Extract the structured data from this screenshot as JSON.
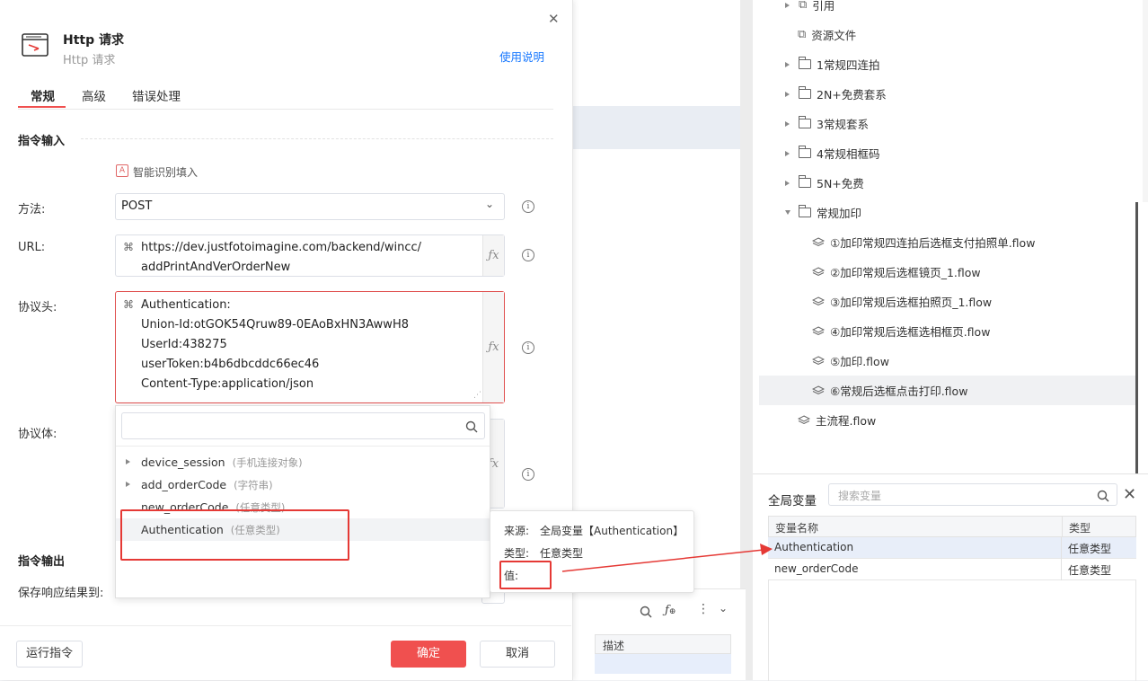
{
  "dialog": {
    "title": "Http 请求",
    "subtitle": "Http 请求",
    "help_link": "使用说明",
    "tabs": [
      "常规",
      "高级",
      "错误处理"
    ],
    "section_input": "指令输入",
    "smart_fill": "智能识别填入",
    "method_label": "方法:",
    "method_value": "POST",
    "url_label": "URL:",
    "url_line1": "https://dev.justfotoimagine.com/backend/wincc/",
    "url_line2": "addPrintAndVerOrderNew",
    "headers_label": "协议头:",
    "headers_lines": [
      "Authentication:",
      "Union-Id:otGOK54Qruw89-0EAoBxHN3AwwH8",
      "UserId:438275",
      "userToken:b4b6dbcddc66ec46",
      "Content-Type:application/json"
    ],
    "body_label": "协议体:",
    "section_output": "指令输出",
    "save_label": "保存响应结果到:",
    "run_button": "运行指令",
    "ok_button": "确定",
    "cancel_button": "取消",
    "fx_label": "ƒx",
    "info_label": "i"
  },
  "var_dropdown": {
    "items": [
      {
        "name": "device_session",
        "type": "(手机连接对象)"
      },
      {
        "name": "add_orderCode",
        "type": "(字符串)"
      },
      {
        "name": "new_orderCode",
        "type": "(任意类型)"
      },
      {
        "name": "Authentication",
        "type": "(任意类型)"
      }
    ]
  },
  "tooltip": {
    "source_label": "来源:",
    "source_value": "全局变量【Authentication】",
    "type_label": "类型:",
    "type_value": "任意类型",
    "value_label": "值:"
  },
  "tree": {
    "items": [
      {
        "label": "引用"
      },
      {
        "label": "资源文件"
      },
      {
        "label": "1常规四连拍"
      },
      {
        "label": "2N+免费套系"
      },
      {
        "label": "3常规套系"
      },
      {
        "label": "4常规相框码"
      },
      {
        "label": "5N+免费"
      },
      {
        "label": "常规加印"
      },
      {
        "label": "①加印常规四连拍后选框支付拍照单.flow"
      },
      {
        "label": "②加印常规后选框镜页_1.flow"
      },
      {
        "label": "③加印常规后选框拍照页_1.flow"
      },
      {
        "label": "④加印常规后选框选相框页.flow"
      },
      {
        "label": "⑤加印.flow"
      },
      {
        "label": "⑥常规后选框点击打印.flow"
      },
      {
        "label": "主流程.flow"
      }
    ]
  },
  "global_vars": {
    "title": "全局变量",
    "search_placeholder": "搜索变量",
    "col_name": "变量名称",
    "col_type": "类型",
    "rows": [
      {
        "name": "Authentication",
        "type": "任意类型"
      },
      {
        "name": "new_orderCode",
        "type": "任意类型"
      }
    ]
  },
  "bottom_panel": {
    "col_desc": "描述"
  },
  "colors": {
    "accent": "#1677ff",
    "danger": "#f0504f",
    "highlight": "#e53935"
  }
}
